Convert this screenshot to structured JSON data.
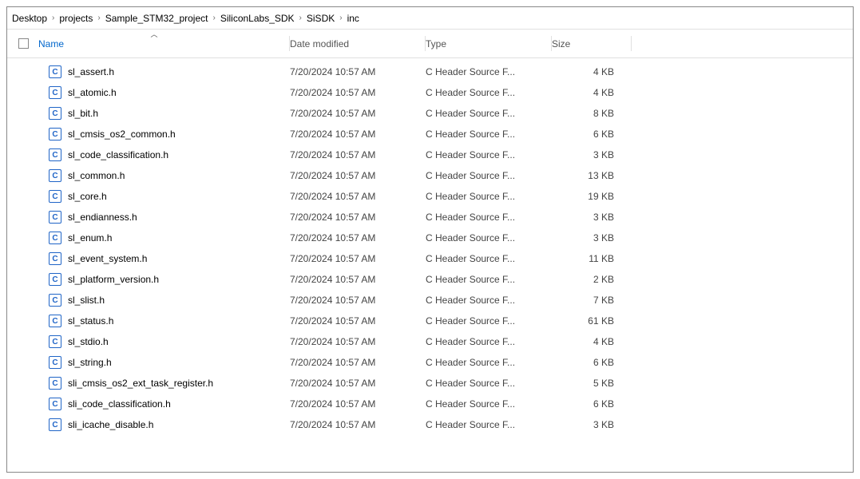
{
  "breadcrumb": [
    "Desktop",
    "projects",
    "Sample_STM32_project",
    "SiliconLabs_SDK",
    "SiSDK",
    "inc"
  ],
  "columns": {
    "name": "Name",
    "date": "Date modified",
    "type": "Type",
    "size": "Size"
  },
  "sort": {
    "column": "name",
    "direction": "asc"
  },
  "files": [
    {
      "icon": "C",
      "name": "sl_assert.h",
      "date": "7/20/2024 10:57 AM",
      "type": "C Header Source F...",
      "size": "4 KB"
    },
    {
      "icon": "C",
      "name": "sl_atomic.h",
      "date": "7/20/2024 10:57 AM",
      "type": "C Header Source F...",
      "size": "4 KB"
    },
    {
      "icon": "C",
      "name": "sl_bit.h",
      "date": "7/20/2024 10:57 AM",
      "type": "C Header Source F...",
      "size": "8 KB"
    },
    {
      "icon": "C",
      "name": "sl_cmsis_os2_common.h",
      "date": "7/20/2024 10:57 AM",
      "type": "C Header Source F...",
      "size": "6 KB"
    },
    {
      "icon": "C",
      "name": "sl_code_classification.h",
      "date": "7/20/2024 10:57 AM",
      "type": "C Header Source F...",
      "size": "3 KB"
    },
    {
      "icon": "C",
      "name": "sl_common.h",
      "date": "7/20/2024 10:57 AM",
      "type": "C Header Source F...",
      "size": "13 KB"
    },
    {
      "icon": "C",
      "name": "sl_core.h",
      "date": "7/20/2024 10:57 AM",
      "type": "C Header Source F...",
      "size": "19 KB"
    },
    {
      "icon": "C",
      "name": "sl_endianness.h",
      "date": "7/20/2024 10:57 AM",
      "type": "C Header Source F...",
      "size": "3 KB"
    },
    {
      "icon": "C",
      "name": "sl_enum.h",
      "date": "7/20/2024 10:57 AM",
      "type": "C Header Source F...",
      "size": "3 KB"
    },
    {
      "icon": "C",
      "name": "sl_event_system.h",
      "date": "7/20/2024 10:57 AM",
      "type": "C Header Source F...",
      "size": "11 KB"
    },
    {
      "icon": "C",
      "name": "sl_platform_version.h",
      "date": "7/20/2024 10:57 AM",
      "type": "C Header Source F...",
      "size": "2 KB"
    },
    {
      "icon": "C",
      "name": "sl_slist.h",
      "date": "7/20/2024 10:57 AM",
      "type": "C Header Source F...",
      "size": "7 KB"
    },
    {
      "icon": "C",
      "name": "sl_status.h",
      "date": "7/20/2024 10:57 AM",
      "type": "C Header Source F...",
      "size": "61 KB"
    },
    {
      "icon": "C",
      "name": "sl_stdio.h",
      "date": "7/20/2024 10:57 AM",
      "type": "C Header Source F...",
      "size": "4 KB"
    },
    {
      "icon": "C",
      "name": "sl_string.h",
      "date": "7/20/2024 10:57 AM",
      "type": "C Header Source F...",
      "size": "6 KB"
    },
    {
      "icon": "C",
      "name": "sli_cmsis_os2_ext_task_register.h",
      "date": "7/20/2024 10:57 AM",
      "type": "C Header Source F...",
      "size": "5 KB"
    },
    {
      "icon": "C",
      "name": "sli_code_classification.h",
      "date": "7/20/2024 10:57 AM",
      "type": "C Header Source F...",
      "size": "6 KB"
    },
    {
      "icon": "C",
      "name": "sli_icache_disable.h",
      "date": "7/20/2024 10:57 AM",
      "type": "C Header Source F...",
      "size": "3 KB"
    }
  ]
}
